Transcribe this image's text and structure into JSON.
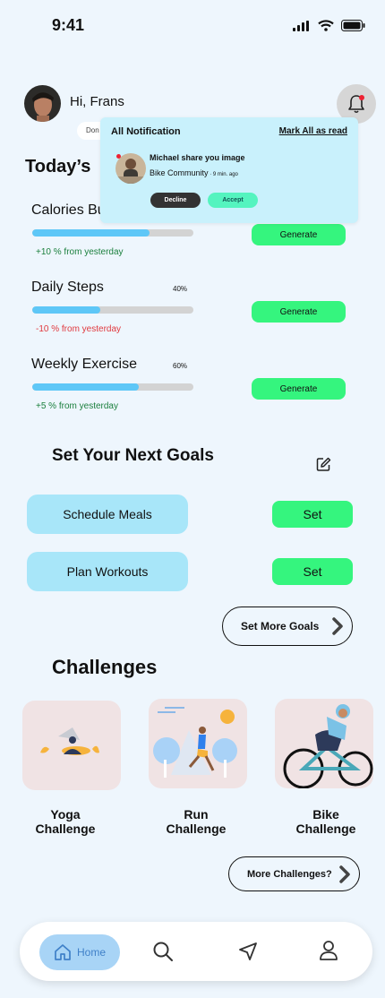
{
  "status": {
    "time": "9:41"
  },
  "header": {
    "greeting": "Hi, Frans",
    "chip_text": "Don"
  },
  "today": {
    "title_visible": "Today’s",
    "metrics": [
      {
        "name": "Calories Bu",
        "percent_label": "",
        "progress": 0.73,
        "delta": "+10 % from yesterday",
        "delta_color": "#1a7f3c",
        "button": "Generate"
      },
      {
        "name": "Daily Steps",
        "percent_label": "40%",
        "progress": 0.42,
        "delta": "-10 % from yesterday",
        "delta_color": "#e0393e",
        "button": "Generate"
      },
      {
        "name": "Weekly Exercise",
        "percent_label": "60%",
        "progress": 0.66,
        "delta": "+5 % from yesterday",
        "delta_color": "#1a7f3c",
        "button": "Generate"
      }
    ]
  },
  "notification": {
    "title": "All Notification",
    "mark_all": "Mark All as read",
    "message": "Michael share you image",
    "source": "Bike Community",
    "separator": " · ",
    "time": "9 min. ago",
    "decline": "Decline",
    "accept": "Accept"
  },
  "goals": {
    "title": "Set Your Next Goals",
    "items": [
      {
        "label": "Schedule Meals",
        "action": "Set"
      },
      {
        "label": "Plan Workouts",
        "action": "Set"
      }
    ],
    "more": "Set More Goals"
  },
  "challenges": {
    "title": "Challenges",
    "items": [
      {
        "line1": "Yoga",
        "line2": "Challenge"
      },
      {
        "line1": "Run",
        "line2": "Challenge"
      },
      {
        "line1": "Bike",
        "line2": "Challenge"
      }
    ],
    "more": "More Challenges?"
  },
  "tabbar": {
    "home": "Home"
  },
  "colors": {
    "accent_green": "#35f57e",
    "progress_blue": "#5ec7f7",
    "goal_blue": "#a8e6f9",
    "popup_bg": "#c9f1fc"
  },
  "icons": [
    "signal-icon",
    "wifi-icon",
    "battery-icon",
    "bell-icon",
    "edit-icon",
    "chevron-right-icon",
    "home-icon",
    "search-icon",
    "navigate-icon",
    "profile-icon"
  ]
}
